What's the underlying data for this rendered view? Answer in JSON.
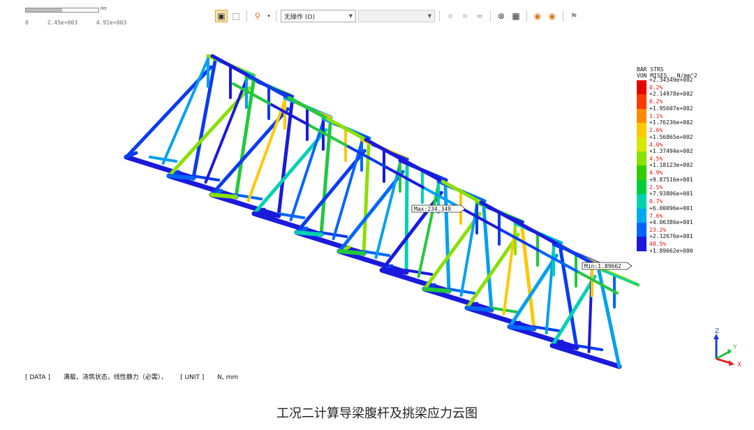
{
  "scale_bar": {
    "unit": "mm",
    "ticks": [
      "0",
      "2.45e+003",
      "4.91e+003"
    ]
  },
  "toolbar": {
    "operation_select": "无操作 (O)",
    "secondary_select": "",
    "icons": [
      "select-frame-icon",
      "select-cursor-icon",
      "display-option-icon",
      "mesh-a-icon",
      "mesh-b-icon",
      "line-icon",
      "tool-x-icon",
      "view-icon",
      "front-icon",
      "back-icon",
      "pin-icon"
    ]
  },
  "legend": {
    "title_line1": "BAR STRS",
    "title_line2": "VON MISES , N/mm^2",
    "values": [
      "+2.34349e+002",
      "+2.14978e+002",
      "+1.95607e+002",
      "+1.76236e+002",
      "+1.56865e+002",
      "+1.37494e+002",
      "+1.18123e+002",
      "+9.87516e+001",
      "+7.93806e+001",
      "+6.00096e+001",
      "+4.06386e+001",
      "+2.12676e+001",
      "+1.89662e+000"
    ],
    "percents": [
      "0.2%",
      "0.2%",
      "1.1%",
      "2.6%",
      "4.0%",
      "4.5%",
      "4.9%",
      "2.5%",
      "0.7%",
      "7.6%",
      "23.2%",
      "48.5%"
    ],
    "colors": [
      "#e60000",
      "#ff3c00",
      "#ff8a00",
      "#ffc800",
      "#d9e600",
      "#8ae000",
      "#33cc00",
      "#00cc3c",
      "#00d2b0",
      "#00aaf0",
      "#0066ff",
      "#1a1adc"
    ]
  },
  "labels": {
    "max": "Max:234.349",
    "min": "Min:1.89662"
  },
  "axis": {
    "z": "Z",
    "y": "Y",
    "x": "X"
  },
  "status": {
    "data_tag": "[ DATA ]",
    "data_value": "满载，浇筑状态，线性静力（必需），",
    "unit_tag": "[ UNIT ]",
    "unit_value": "N,  mm"
  },
  "caption": "工况二计算导梁腹杆及挑梁应力云图"
}
